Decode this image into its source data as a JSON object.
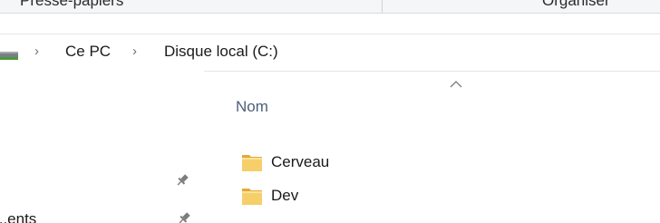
{
  "ribbon": {
    "left_label": "Presse-papiers",
    "right_label": "Organiser"
  },
  "address_bar": {
    "drive_icon": "drive-icon",
    "crumbs": [
      {
        "label": "Ce PC"
      },
      {
        "label": "Disque local (C:)"
      }
    ],
    "separator_icon": "chevron-right-icon"
  },
  "nav_pane": {
    "partial_item_label": "...ents",
    "pin_icon": "pin-icon"
  },
  "content": {
    "column_header": "Nom",
    "sort_icon": "sort-ascending-icon",
    "items": [
      {
        "name": "Cerveau",
        "icon": "folder-icon"
      },
      {
        "name": "Dev",
        "icon": "folder-icon"
      }
    ]
  },
  "colors": {
    "folder": "#f3c85c",
    "header_text": "#4c607a",
    "ribbon_bg": "#f5f6f7"
  }
}
